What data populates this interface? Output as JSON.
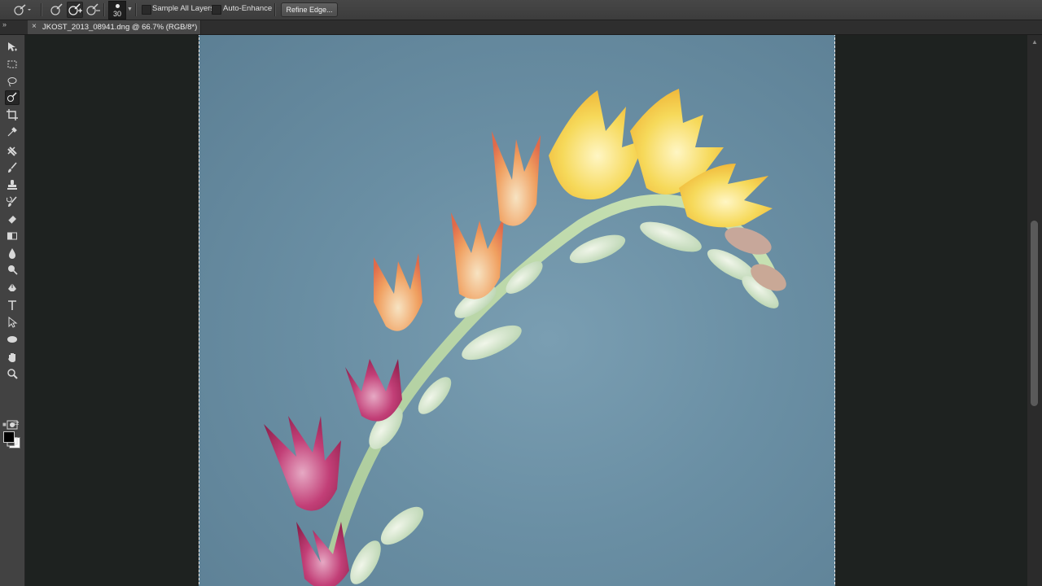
{
  "options_bar": {
    "tool_preset_icon": "quick-selection-brush-icon",
    "modes": [
      "new-selection-icon",
      "add-to-selection-icon",
      "subtract-from-selection-icon"
    ],
    "active_mode": "add-to-selection",
    "brush_size": "30",
    "sample_all_layers_label": "Sample All Layers",
    "sample_all_layers_checked": false,
    "auto_enhance_label": "Auto-Enhance",
    "auto_enhance_checked": false,
    "refine_edge_label": "Refine Edge..."
  },
  "document": {
    "tab_title": "JKOST_2013_08941.dng @ 66.7% (RGB/8*)",
    "close_glyph": "×"
  },
  "toolbar": {
    "collapse_glyph": "»",
    "tools": [
      "move-tool-icon",
      "marquee-tool-icon",
      "lasso-tool-icon",
      "quick-selection-tool-icon",
      "crop-tool-icon",
      "eyedropper-tool-icon",
      "healing-brush-tool-icon",
      "brush-tool-icon",
      "clone-stamp-tool-icon",
      "history-brush-tool-icon",
      "eraser-tool-icon",
      "gradient-tool-icon",
      "blur-tool-icon",
      "dodge-tool-icon",
      "pen-tool-icon",
      "type-tool-icon",
      "path-selection-tool-icon",
      "ellipse-tool-icon",
      "hand-tool-icon",
      "zoom-tool-icon",
      "quick-mask-icon",
      "screen-mode-icon"
    ],
    "selected_tool": "quick-selection-tool-icon",
    "foreground_color": "#000000",
    "background_color": "#ffffff"
  },
  "colors": {
    "ui_dark": "#2b2b2b",
    "canvas_bg": "#1e2220",
    "photo_bg": "#6a8fa4"
  }
}
